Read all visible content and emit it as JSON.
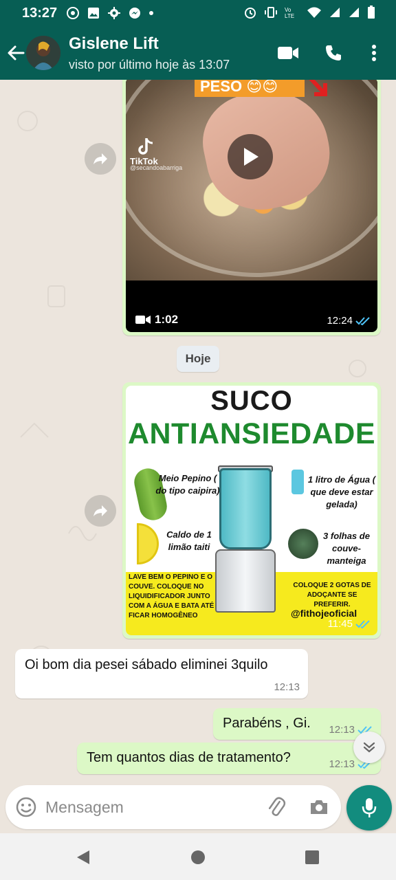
{
  "status_bar": {
    "time": "13:27"
  },
  "header": {
    "contact_name": "Gislene Lift",
    "contact_status": "visto por último hoje às 13:07"
  },
  "messages": {
    "video": {
      "duration": "1:02",
      "time": "12:24",
      "overlay_text": "PESO",
      "tiktok_label": "TikTok",
      "tiktok_handle": "@secandoabarriga"
    },
    "date_divider": "Hoje",
    "image": {
      "time": "11:45",
      "title_line1": "SUCO",
      "title_line2": "ANTIANSIEDADE",
      "item_cucumber": "Meio Pepino ( do tipo caipira)",
      "item_lemon": "Caldo de 1 limão taiti",
      "item_water": "1 litro de Água ( que deve estar gelada)",
      "item_kale": "3 folhas de couve-manteiga",
      "instructions_left": "LAVE BEM O PEPINO E O COUVE. COLOQUE NO LIQUIDIFICADOR JUNTO COM A ÁGUA E BATA ATÉ FICAR HOMOGÊNEO",
      "instructions_right": "COLOQUE 2 GOTAS DE ADOÇANTE SE PREFERIR.",
      "brand": "@fithojeoficial"
    },
    "incoming_1": {
      "text": "Oi bom dia pesei sábado eliminei 3quilo",
      "time": "12:13"
    },
    "outgoing_1": {
      "text": "Parabéns , Gi.",
      "time": "12:13"
    },
    "outgoing_2": {
      "text": "Tem quantos dias de tratamento?",
      "time": "12:13"
    }
  },
  "input": {
    "placeholder": "Mensagem"
  },
  "colors": {
    "header": "#075e54",
    "outgoing_bubble": "#dcf8c6",
    "incoming_bubble": "#ffffff",
    "chat_background": "#ece5dd",
    "read_ticks": "#4fc3f7",
    "mic_button": "#128c7e"
  }
}
